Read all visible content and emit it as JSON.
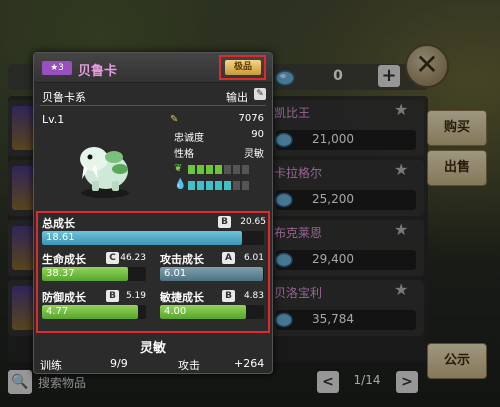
{
  "background": {
    "currency_count": "0",
    "plus_label": "+",
    "close_label": "✕",
    "rows": [
      {
        "name": "凯比王",
        "price": "21,000"
      },
      {
        "name": "卡拉格尔",
        "price": "25,200"
      },
      {
        "name": "布克莱恩",
        "price": "29,400"
      },
      {
        "name": "贝洛宝利",
        "price": "35,784"
      }
    ],
    "buttons": {
      "buy": "购买",
      "sell": "出售",
      "notice": "公示"
    },
    "search_label": "搜索物品",
    "pager": {
      "current": "1/14",
      "prev": "<",
      "next": ">"
    }
  },
  "card": {
    "rank": "3",
    "name": "贝鲁卡",
    "grade_tag": "极品",
    "family": "贝鲁卡系",
    "role": "输出",
    "level": "Lv.1",
    "power": "7076",
    "loyalty_label": "忠诚度",
    "loyalty_value": "90",
    "personality_label": "性格",
    "personality_value": "灵敏",
    "bars": {
      "green_on": 4,
      "cyan_on": 5,
      "total_segments": 7
    },
    "growth": {
      "total": {
        "label": "总成长",
        "grade": "B",
        "value": "20.65",
        "bar": "18.61",
        "fill": 0.9
      },
      "hp": {
        "label": "生命成长",
        "grade": "C",
        "value": "46.23",
        "bar": "38.37",
        "fill": 0.83
      },
      "atk": {
        "label": "攻击成长",
        "grade": "A",
        "value": "6.01",
        "bar": "6.01",
        "fill": 0.99
      },
      "def": {
        "label": "防御成长",
        "grade": "B",
        "value": "5.19",
        "bar": "4.77",
        "fill": 0.92
      },
      "agi": {
        "label": "敏捷成长",
        "grade": "B",
        "value": "4.83",
        "bar": "4.00",
        "fill": 0.83
      }
    },
    "trait": "灵敏",
    "training_label": "训练",
    "training_value": "9/9",
    "attack_label": "攻击",
    "attack_value": "+264"
  },
  "colors": {
    "rank_purple": "#9a4fbf",
    "highlight_red": "#e02a2a",
    "name_pink": "#e79be0"
  }
}
